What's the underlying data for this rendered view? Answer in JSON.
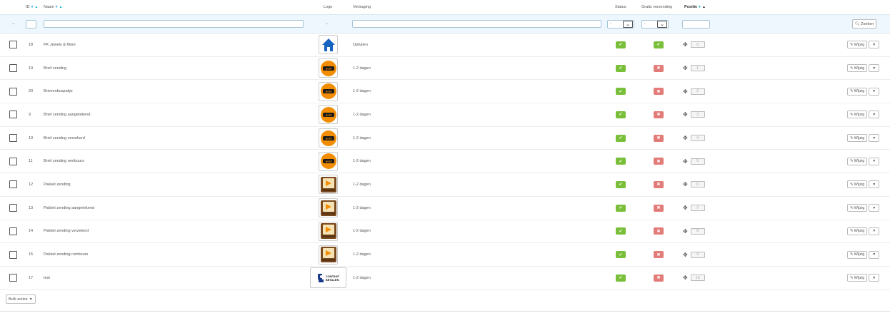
{
  "header": {
    "id": "ID",
    "naam": "Naam",
    "logo": "Logo",
    "vertraging": "Vertraging",
    "status": "Status",
    "gratis": "Gratis verzending",
    "positie": "Positie",
    "sort_down": "▼",
    "sort_up": "▲"
  },
  "filter": {
    "dash": "--",
    "logo_dash": "--",
    "status_value": "-",
    "gratis_value": "-",
    "search_label": "Zoeken"
  },
  "rows": [
    {
      "id": "18",
      "name": "PK Jewels & More",
      "logo": "home",
      "delay": "Ophalen",
      "status": true,
      "free": true,
      "position": "0"
    },
    {
      "id": "19",
      "name": "Brief zending",
      "logo": "postnl",
      "delay": "1-2 dagen",
      "status": true,
      "free": false,
      "position": "1"
    },
    {
      "id": "20",
      "name": "Brievenbuspakje",
      "logo": "postnl",
      "delay": "1-2 dagen",
      "status": true,
      "free": false,
      "position": "2"
    },
    {
      "id": "9",
      "name": "Brief zending aangetekend",
      "logo": "postnl",
      "delay": "1-2 dagen",
      "status": true,
      "free": false,
      "position": "3"
    },
    {
      "id": "10",
      "name": "Brief zending verzekerd",
      "logo": "postnl",
      "delay": "1-2 dagen",
      "status": true,
      "free": false,
      "position": "4"
    },
    {
      "id": "11",
      "name": "Brief zending rembours",
      "logo": "postnl",
      "delay": "1-2 dagen",
      "status": true,
      "free": false,
      "position": "5"
    },
    {
      "id": "12",
      "name": "Pakket zending",
      "logo": "parcel",
      "delay": "1-2 dagen",
      "status": true,
      "free": false,
      "position": "6"
    },
    {
      "id": "13",
      "name": "Pakket zending aangetekend",
      "logo": "parcel",
      "delay": "1-2 dagen",
      "status": true,
      "free": false,
      "position": "7"
    },
    {
      "id": "14",
      "name": "Pakket zending verzekerd",
      "logo": "parcel",
      "delay": "1-2 dagen",
      "status": true,
      "free": false,
      "position": "8"
    },
    {
      "id": "15",
      "name": "Pakket zending rembours",
      "logo": "parcel",
      "delay": "1-2 dagen",
      "status": true,
      "free": false,
      "position": "9"
    },
    {
      "id": "17",
      "name": "test",
      "logo": "contant",
      "delay": "1-2 dagen",
      "status": true,
      "free": false,
      "position": "10"
    }
  ],
  "logo_text": {
    "post": "post",
    "contant_1": "CONTANT",
    "contant_2": "BETALEN"
  },
  "actions": {
    "edit_label": "Wijzig",
    "bulk_label": "Bulk acties"
  },
  "colors": {
    "accent": "#25b9d7",
    "ok": "#79bf3a",
    "no": "#e27c79",
    "postnl": "#f28c00"
  }
}
